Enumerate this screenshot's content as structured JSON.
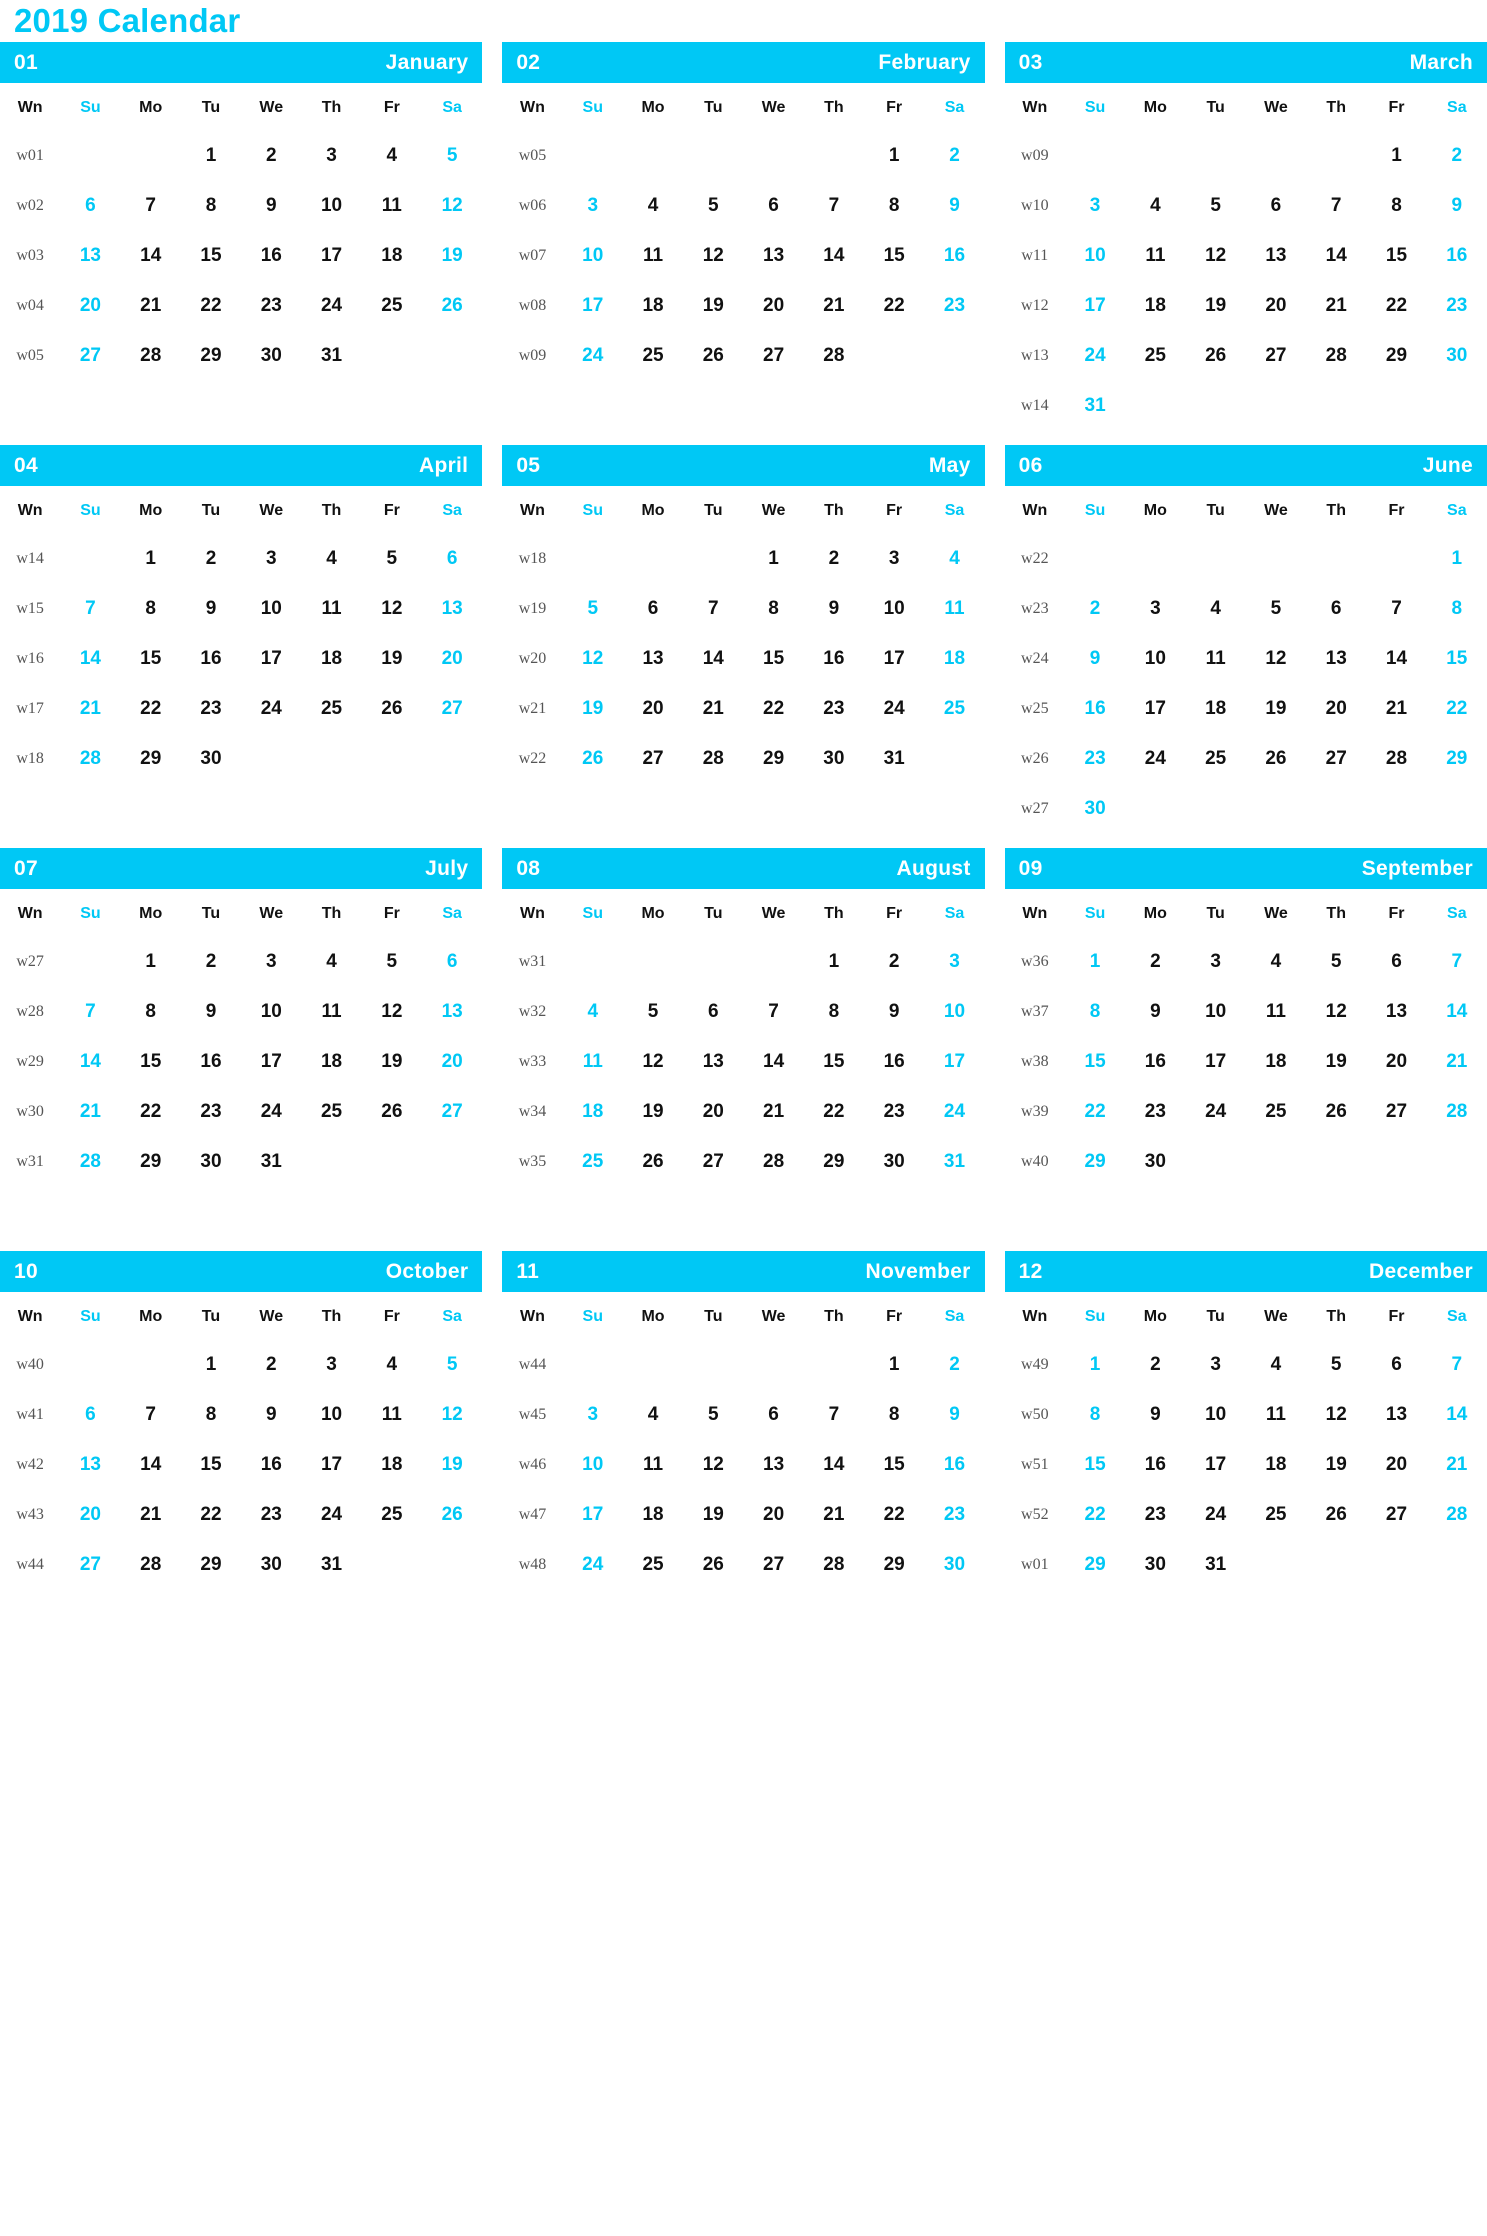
{
  "title": "2019 Calendar",
  "colors": {
    "accent": "#00c8f5",
    "header_text": "#ffffff",
    "day_text": "#111111",
    "week_number_text": "#555555",
    "background": "#ffffff"
  },
  "weekday_headers": [
    "Wn",
    "Su",
    "Mo",
    "Tu",
    "We",
    "Th",
    "Fr",
    "Sa"
  ],
  "weekend_columns": [
    1,
    7
  ],
  "calendar_data": {
    "year": 2019,
    "week_start": "Sunday",
    "months": [
      {
        "number": "01",
        "name": "January",
        "weeks": [
          {
            "wn": "w01",
            "days": [
              "",
              "",
              "1",
              "2",
              "3",
              "4",
              "5"
            ]
          },
          {
            "wn": "w02",
            "days": [
              "6",
              "7",
              "8",
              "9",
              "10",
              "11",
              "12"
            ]
          },
          {
            "wn": "w03",
            "days": [
              "13",
              "14",
              "15",
              "16",
              "17",
              "18",
              "19"
            ]
          },
          {
            "wn": "w04",
            "days": [
              "20",
              "21",
              "22",
              "23",
              "24",
              "25",
              "26"
            ]
          },
          {
            "wn": "w05",
            "days": [
              "27",
              "28",
              "29",
              "30",
              "31",
              "",
              ""
            ]
          },
          {
            "wn": "",
            "days": [
              "",
              "",
              "",
              "",
              "",
              "",
              ""
            ]
          }
        ]
      },
      {
        "number": "02",
        "name": "February",
        "weeks": [
          {
            "wn": "w05",
            "days": [
              "",
              "",
              "",
              "",
              "",
              "1",
              "2"
            ]
          },
          {
            "wn": "w06",
            "days": [
              "3",
              "4",
              "5",
              "6",
              "7",
              "8",
              "9"
            ]
          },
          {
            "wn": "w07",
            "days": [
              "10",
              "11",
              "12",
              "13",
              "14",
              "15",
              "16"
            ]
          },
          {
            "wn": "w08",
            "days": [
              "17",
              "18",
              "19",
              "20",
              "21",
              "22",
              "23"
            ]
          },
          {
            "wn": "w09",
            "days": [
              "24",
              "25",
              "26",
              "27",
              "28",
              "",
              ""
            ]
          },
          {
            "wn": "",
            "days": [
              "",
              "",
              "",
              "",
              "",
              "",
              ""
            ]
          }
        ]
      },
      {
        "number": "03",
        "name": "March",
        "weeks": [
          {
            "wn": "w09",
            "days": [
              "",
              "",
              "",
              "",
              "",
              "1",
              "2"
            ]
          },
          {
            "wn": "w10",
            "days": [
              "3",
              "4",
              "5",
              "6",
              "7",
              "8",
              "9"
            ]
          },
          {
            "wn": "w11",
            "days": [
              "10",
              "11",
              "12",
              "13",
              "14",
              "15",
              "16"
            ]
          },
          {
            "wn": "w12",
            "days": [
              "17",
              "18",
              "19",
              "20",
              "21",
              "22",
              "23"
            ]
          },
          {
            "wn": "w13",
            "days": [
              "24",
              "25",
              "26",
              "27",
              "28",
              "29",
              "30"
            ]
          },
          {
            "wn": "w14",
            "days": [
              "31",
              "",
              "",
              "",
              "",
              "",
              ""
            ]
          }
        ]
      },
      {
        "number": "04",
        "name": "April",
        "weeks": [
          {
            "wn": "w14",
            "days": [
              "",
              "1",
              "2",
              "3",
              "4",
              "5",
              "6"
            ]
          },
          {
            "wn": "w15",
            "days": [
              "7",
              "8",
              "9",
              "10",
              "11",
              "12",
              "13"
            ]
          },
          {
            "wn": "w16",
            "days": [
              "14",
              "15",
              "16",
              "17",
              "18",
              "19",
              "20"
            ]
          },
          {
            "wn": "w17",
            "days": [
              "21",
              "22",
              "23",
              "24",
              "25",
              "26",
              "27"
            ]
          },
          {
            "wn": "w18",
            "days": [
              "28",
              "29",
              "30",
              "",
              "",
              "",
              ""
            ]
          },
          {
            "wn": "",
            "days": [
              "",
              "",
              "",
              "",
              "",
              "",
              ""
            ]
          }
        ]
      },
      {
        "number": "05",
        "name": "May",
        "weeks": [
          {
            "wn": "w18",
            "days": [
              "",
              "",
              "",
              "1",
              "2",
              "3",
              "4"
            ]
          },
          {
            "wn": "w19",
            "days": [
              "5",
              "6",
              "7",
              "8",
              "9",
              "10",
              "11"
            ]
          },
          {
            "wn": "w20",
            "days": [
              "12",
              "13",
              "14",
              "15",
              "16",
              "17",
              "18"
            ]
          },
          {
            "wn": "w21",
            "days": [
              "19",
              "20",
              "21",
              "22",
              "23",
              "24",
              "25"
            ]
          },
          {
            "wn": "w22",
            "days": [
              "26",
              "27",
              "28",
              "29",
              "30",
              "31",
              ""
            ]
          },
          {
            "wn": "",
            "days": [
              "",
              "",
              "",
              "",
              "",
              "",
              ""
            ]
          }
        ]
      },
      {
        "number": "06",
        "name": "June",
        "weeks": [
          {
            "wn": "w22",
            "days": [
              "",
              "",
              "",
              "",
              "",
              "",
              "1"
            ]
          },
          {
            "wn": "w23",
            "days": [
              "2",
              "3",
              "4",
              "5",
              "6",
              "7",
              "8"
            ]
          },
          {
            "wn": "w24",
            "days": [
              "9",
              "10",
              "11",
              "12",
              "13",
              "14",
              "15"
            ]
          },
          {
            "wn": "w25",
            "days": [
              "16",
              "17",
              "18",
              "19",
              "20",
              "21",
              "22"
            ]
          },
          {
            "wn": "w26",
            "days": [
              "23",
              "24",
              "25",
              "26",
              "27",
              "28",
              "29"
            ]
          },
          {
            "wn": "w27",
            "days": [
              "30",
              "",
              "",
              "",
              "",
              "",
              ""
            ]
          }
        ]
      },
      {
        "number": "07",
        "name": "July",
        "weeks": [
          {
            "wn": "w27",
            "days": [
              "",
              "1",
              "2",
              "3",
              "4",
              "5",
              "6"
            ]
          },
          {
            "wn": "w28",
            "days": [
              "7",
              "8",
              "9",
              "10",
              "11",
              "12",
              "13"
            ]
          },
          {
            "wn": "w29",
            "days": [
              "14",
              "15",
              "16",
              "17",
              "18",
              "19",
              "20"
            ]
          },
          {
            "wn": "w30",
            "days": [
              "21",
              "22",
              "23",
              "24",
              "25",
              "26",
              "27"
            ]
          },
          {
            "wn": "w31",
            "days": [
              "28",
              "29",
              "30",
              "31",
              "",
              "",
              ""
            ]
          },
          {
            "wn": "",
            "days": [
              "",
              "",
              "",
              "",
              "",
              "",
              ""
            ]
          }
        ]
      },
      {
        "number": "08",
        "name": "August",
        "weeks": [
          {
            "wn": "w31",
            "days": [
              "",
              "",
              "",
              "",
              "1",
              "2",
              "3"
            ]
          },
          {
            "wn": "w32",
            "days": [
              "4",
              "5",
              "6",
              "7",
              "8",
              "9",
              "10"
            ]
          },
          {
            "wn": "w33",
            "days": [
              "11",
              "12",
              "13",
              "14",
              "15",
              "16",
              "17"
            ]
          },
          {
            "wn": "w34",
            "days": [
              "18",
              "19",
              "20",
              "21",
              "22",
              "23",
              "24"
            ]
          },
          {
            "wn": "w35",
            "days": [
              "25",
              "26",
              "27",
              "28",
              "29",
              "30",
              "31"
            ]
          },
          {
            "wn": "",
            "days": [
              "",
              "",
              "",
              "",
              "",
              "",
              ""
            ]
          }
        ]
      },
      {
        "number": "09",
        "name": "September",
        "weeks": [
          {
            "wn": "w36",
            "days": [
              "1",
              "2",
              "3",
              "4",
              "5",
              "6",
              "7"
            ]
          },
          {
            "wn": "w37",
            "days": [
              "8",
              "9",
              "10",
              "11",
              "12",
              "13",
              "14"
            ]
          },
          {
            "wn": "w38",
            "days": [
              "15",
              "16",
              "17",
              "18",
              "19",
              "20",
              "21"
            ]
          },
          {
            "wn": "w39",
            "days": [
              "22",
              "23",
              "24",
              "25",
              "26",
              "27",
              "28"
            ]
          },
          {
            "wn": "w40",
            "days": [
              "29",
              "30",
              "",
              "",
              "",
              "",
              ""
            ]
          },
          {
            "wn": "",
            "days": [
              "",
              "",
              "",
              "",
              "",
              "",
              ""
            ]
          }
        ]
      },
      {
        "number": "10",
        "name": "October",
        "weeks": [
          {
            "wn": "w40",
            "days": [
              "",
              "",
              "1",
              "2",
              "3",
              "4",
              "5"
            ]
          },
          {
            "wn": "w41",
            "days": [
              "6",
              "7",
              "8",
              "9",
              "10",
              "11",
              "12"
            ]
          },
          {
            "wn": "w42",
            "days": [
              "13",
              "14",
              "15",
              "16",
              "17",
              "18",
              "19"
            ]
          },
          {
            "wn": "w43",
            "days": [
              "20",
              "21",
              "22",
              "23",
              "24",
              "25",
              "26"
            ]
          },
          {
            "wn": "w44",
            "days": [
              "27",
              "28",
              "29",
              "30",
              "31",
              "",
              ""
            ]
          },
          {
            "wn": "",
            "days": [
              "",
              "",
              "",
              "",
              "",
              "",
              ""
            ]
          }
        ]
      },
      {
        "number": "11",
        "name": "November",
        "weeks": [
          {
            "wn": "w44",
            "days": [
              "",
              "",
              "",
              "",
              "",
              "1",
              "2"
            ]
          },
          {
            "wn": "w45",
            "days": [
              "3",
              "4",
              "5",
              "6",
              "7",
              "8",
              "9"
            ]
          },
          {
            "wn": "w46",
            "days": [
              "10",
              "11",
              "12",
              "13",
              "14",
              "15",
              "16"
            ]
          },
          {
            "wn": "w47",
            "days": [
              "17",
              "18",
              "19",
              "20",
              "21",
              "22",
              "23"
            ]
          },
          {
            "wn": "w48",
            "days": [
              "24",
              "25",
              "26",
              "27",
              "28",
              "29",
              "30"
            ]
          },
          {
            "wn": "",
            "days": [
              "",
              "",
              "",
              "",
              "",
              "",
              ""
            ]
          }
        ]
      },
      {
        "number": "12",
        "name": "December",
        "weeks": [
          {
            "wn": "w49",
            "days": [
              "1",
              "2",
              "3",
              "4",
              "5",
              "6",
              "7"
            ]
          },
          {
            "wn": "w50",
            "days": [
              "8",
              "9",
              "10",
              "11",
              "12",
              "13",
              "14"
            ]
          },
          {
            "wn": "w51",
            "days": [
              "15",
              "16",
              "17",
              "18",
              "19",
              "20",
              "21"
            ]
          },
          {
            "wn": "w52",
            "days": [
              "22",
              "23",
              "24",
              "25",
              "26",
              "27",
              "28"
            ]
          },
          {
            "wn": "w01",
            "days": [
              "29",
              "30",
              "31",
              "",
              "",
              "",
              ""
            ]
          },
          {
            "wn": "",
            "days": [
              "",
              "",
              "",
              "",
              "",
              "",
              ""
            ]
          }
        ]
      }
    ]
  }
}
